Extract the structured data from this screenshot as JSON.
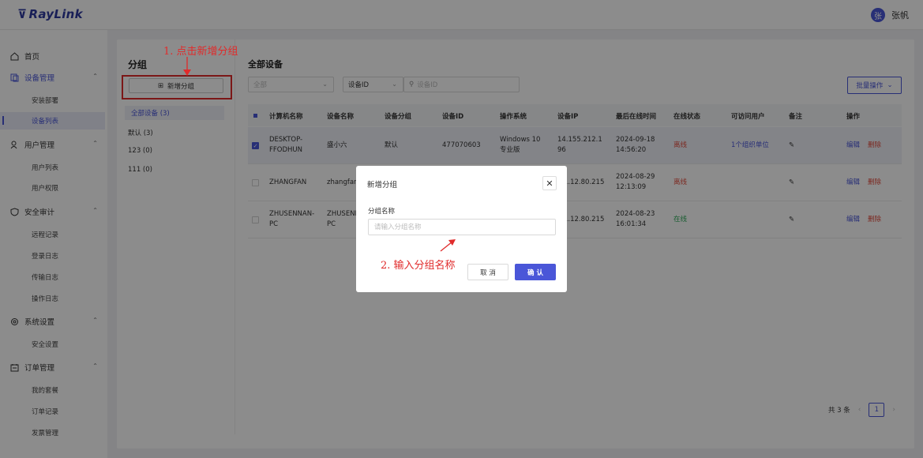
{
  "app": {
    "logo": "RayLink",
    "user_avatar": "张",
    "user_name": "张帆"
  },
  "sidebar": {
    "home": "首页",
    "device_mgmt": "设备管理",
    "install_deploy": "安装部署",
    "device_list": "设备列表",
    "user_mgmt": "用户管理",
    "user_list": "用户列表",
    "user_perm": "用户权限",
    "security_audit": "安全审计",
    "remote_log": "远程记录",
    "login_log": "登录日志",
    "transfer_log": "传输日志",
    "operation_log": "操作日志",
    "system_settings": "系统设置",
    "security_settings": "安全设置",
    "order_mgmt": "订单管理",
    "my_plan": "我的套餐",
    "order_records": "订单记录",
    "invoice_mgmt": "发票管理"
  },
  "groups": {
    "title": "分组",
    "new_button": "新增分组",
    "items": [
      "全部设备 (3)",
      "默认 (3)",
      "123 (0)",
      "111 (0)"
    ]
  },
  "annotations": {
    "step1": "1. 点击新增分组",
    "step2": "2. 输入分组名称"
  },
  "devices": {
    "title": "全部设备",
    "filter_all": "全部",
    "filter_field": "设备ID",
    "search_placeholder": "设备ID",
    "batch_button": "批量操作",
    "headers": [
      "计算机名称",
      "设备名称",
      "设备分组",
      "设备ID",
      "操作系统",
      "设备IP",
      "最后在线时间",
      "在线状态",
      "可访问用户",
      "备注",
      "操作"
    ],
    "rows": [
      {
        "computer": "DESKTOP-FFODHUN",
        "device_name": "盛小六",
        "group": "默认",
        "id": "477070603",
        "os": "Windows 10 专业版",
        "ip": "14.155.212.196",
        "last_online": "2024-09-18 14:56:20",
        "status": "离线",
        "users": "1个组织单位",
        "edit": "编辑",
        "delete": "删除"
      },
      {
        "computer": "ZHANGFAN",
        "device_name": "zhangfan",
        "ip": "1.12.80.215",
        "last_online": "2024-08-29 12:13:09",
        "status": "离线",
        "edit": "编辑",
        "delete": "删除"
      },
      {
        "computer": "ZHUSENNAN-PC",
        "device_name": "ZHUSENN PC",
        "ip": "1.12.80.215",
        "last_online": "2024-08-23 16:01:34",
        "status": "在线",
        "edit": "编辑",
        "delete": "删除"
      }
    ]
  },
  "pagination": {
    "total": "共 3 条",
    "page": "1"
  },
  "modal": {
    "title": "新增分组",
    "label": "分组名称",
    "placeholder": "请输入分组名称",
    "cancel": "取 消",
    "ok": "确 认"
  },
  "colors": {
    "accent": "#4a56d8",
    "annotation": "#e02b2b",
    "offline": "#e24a3b",
    "online": "#2eaa5a"
  }
}
